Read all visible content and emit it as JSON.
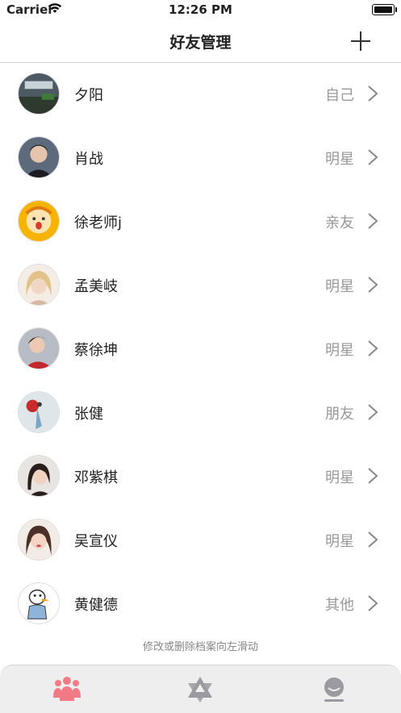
{
  "status_bar": {
    "carrier": "Carrier",
    "time": "12:26 PM"
  },
  "nav": {
    "title": "好友管理",
    "add_icon": "plus-icon"
  },
  "friends": [
    {
      "name": "夕阳",
      "group": "自己"
    },
    {
      "name": "肖战",
      "group": "明星"
    },
    {
      "name": "徐老师j",
      "group": "亲友"
    },
    {
      "name": "孟美岐",
      "group": "明星"
    },
    {
      "name": "蔡徐坤",
      "group": "明星"
    },
    {
      "name": "张健",
      "group": "朋友"
    },
    {
      "name": "邓紫棋",
      "group": "明星"
    },
    {
      "name": "吴宣仪",
      "group": "明星"
    },
    {
      "name": "黄健德",
      "group": "其他"
    }
  ],
  "hint": "修改或删除档案向左滑动",
  "tabs": [
    {
      "icon": "friends-icon",
      "active": true
    },
    {
      "icon": "star-of-david-icon",
      "active": false
    },
    {
      "icon": "profile-icon",
      "active": false
    }
  ],
  "colors": {
    "accent": "#f07b86",
    "inactive_tab": "#9a9aa0",
    "secondary_text": "#999999"
  }
}
